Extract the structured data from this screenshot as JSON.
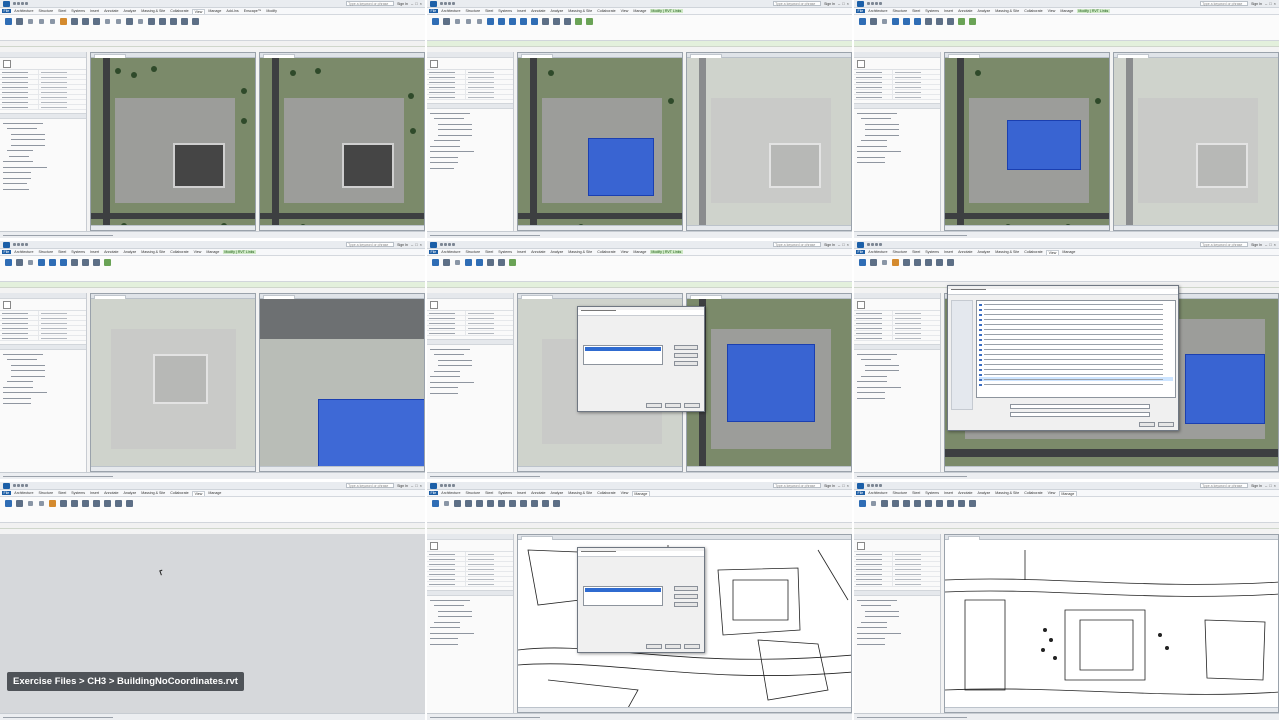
{
  "breadcrumb": {
    "text": "Exercise Files > CH3 > BuildingNoCoordinates.rvt"
  },
  "app": {
    "ribbon_tabs": [
      "File",
      "Architecture",
      "Structure",
      "Steel",
      "Systems",
      "Insert",
      "Annotate",
      "Analyze",
      "Massing & Site",
      "Collaborate",
      "View",
      "Manage",
      "Add-Ins",
      "Enscape™",
      "Modify"
    ],
    "context_tab": "Modify | RVT Links",
    "search_placeholder": "Type a keyword or phrase",
    "sign_in": "Sign In"
  },
  "colors": {
    "file_tab": "#1d5ea5",
    "context_tab": "#cfe9c6",
    "selection_blue": "#285adc",
    "site_green": "#7b8a6a"
  },
  "icons": [
    "application-menu-icon",
    "quick-access-icon",
    "minimize-icon",
    "maximize-icon",
    "close-icon"
  ]
}
